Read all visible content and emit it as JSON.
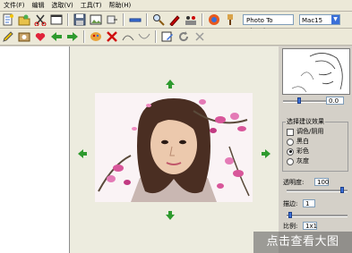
{
  "menu": [
    {
      "label": "文件(F)"
    },
    {
      "label": "编辑"
    },
    {
      "label": "选取(V)"
    },
    {
      "label": "工具(T)"
    },
    {
      "label": "帮助(H)"
    }
  ],
  "toolbar": {
    "style_value": "Photo To Sketch",
    "mode_value": "Mac15"
  },
  "right_panel": {
    "spin_value": "0.0",
    "group_title": "选择建议效果",
    "checkbox_label": "调色/阴用",
    "radio_options": [
      {
        "label": "黑白",
        "selected": false
      },
      {
        "label": "彩色",
        "selected": true
      },
      {
        "label": "灰度",
        "selected": false
      }
    ],
    "transparency_label": "透明度:",
    "transparency_value": "100",
    "brush_label": "描边:",
    "brush_value": "1",
    "ratio_label": "比例:",
    "ratio_value": "1x1"
  },
  "watermark": "点击查看大图"
}
